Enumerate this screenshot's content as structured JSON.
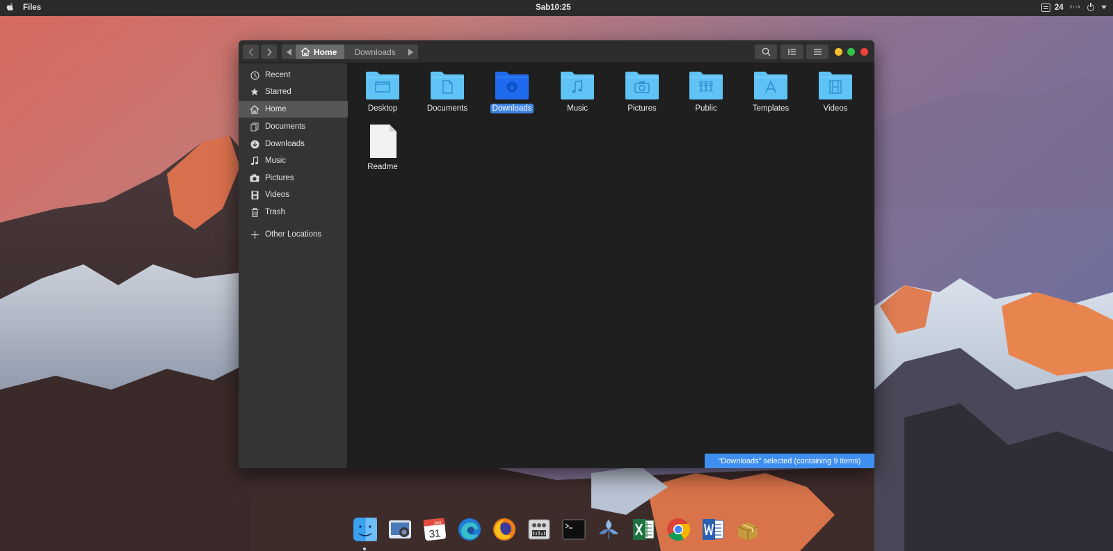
{
  "topbar": {
    "app_name": "Files",
    "clock": "Sab10:25",
    "tray_number": "24",
    "tray_network": "‹··›"
  },
  "headerbar": {
    "breadcrumbs": [
      "Home",
      "Downloads"
    ]
  },
  "sidebar": {
    "items": [
      {
        "label": "Recent",
        "icon": "clock-icon"
      },
      {
        "label": "Starred",
        "icon": "star-icon"
      },
      {
        "label": "Home",
        "icon": "home-icon",
        "active": true
      },
      {
        "label": "Documents",
        "icon": "documents-icon"
      },
      {
        "label": "Downloads",
        "icon": "download-icon"
      },
      {
        "label": "Music",
        "icon": "music-icon"
      },
      {
        "label": "Pictures",
        "icon": "camera-icon"
      },
      {
        "label": "Videos",
        "icon": "film-icon"
      },
      {
        "label": "Trash",
        "icon": "trash-icon"
      },
      {
        "label": "Other Locations",
        "icon": "plus-icon"
      }
    ]
  },
  "files": [
    {
      "name": "Desktop",
      "type": "folder",
      "glyph": "desktop"
    },
    {
      "name": "Documents",
      "type": "folder",
      "glyph": "document"
    },
    {
      "name": "Downloads",
      "type": "folder",
      "glyph": "download",
      "selected": true
    },
    {
      "name": "Music",
      "type": "folder",
      "glyph": "music"
    },
    {
      "name": "Pictures",
      "type": "folder",
      "glyph": "camera"
    },
    {
      "name": "Public",
      "type": "folder",
      "glyph": "people"
    },
    {
      "name": "Templates",
      "type": "folder",
      "glyph": "templates"
    },
    {
      "name": "Videos",
      "type": "folder",
      "glyph": "film"
    },
    {
      "name": "Readme",
      "type": "file",
      "glyph": "text-file"
    }
  ],
  "status": "“Downloads” selected  (containing 9 items)",
  "dock": [
    "finder-icon",
    "image-capture-icon",
    "calendar-icon",
    "edge-icon",
    "firefox-icon",
    "system-monitor-icon",
    "terminal-icon",
    "shotwell-icon",
    "excel-icon",
    "chrome-icon",
    "word-icon",
    "archive-icon"
  ],
  "dock_calendar": {
    "month": "JAN",
    "day": "31"
  },
  "colors": {
    "folder": "#5fc3f5",
    "folder_selected": "#1e6bf0",
    "selection": "#3f84e5",
    "status_bar": "#3f8ff0"
  }
}
